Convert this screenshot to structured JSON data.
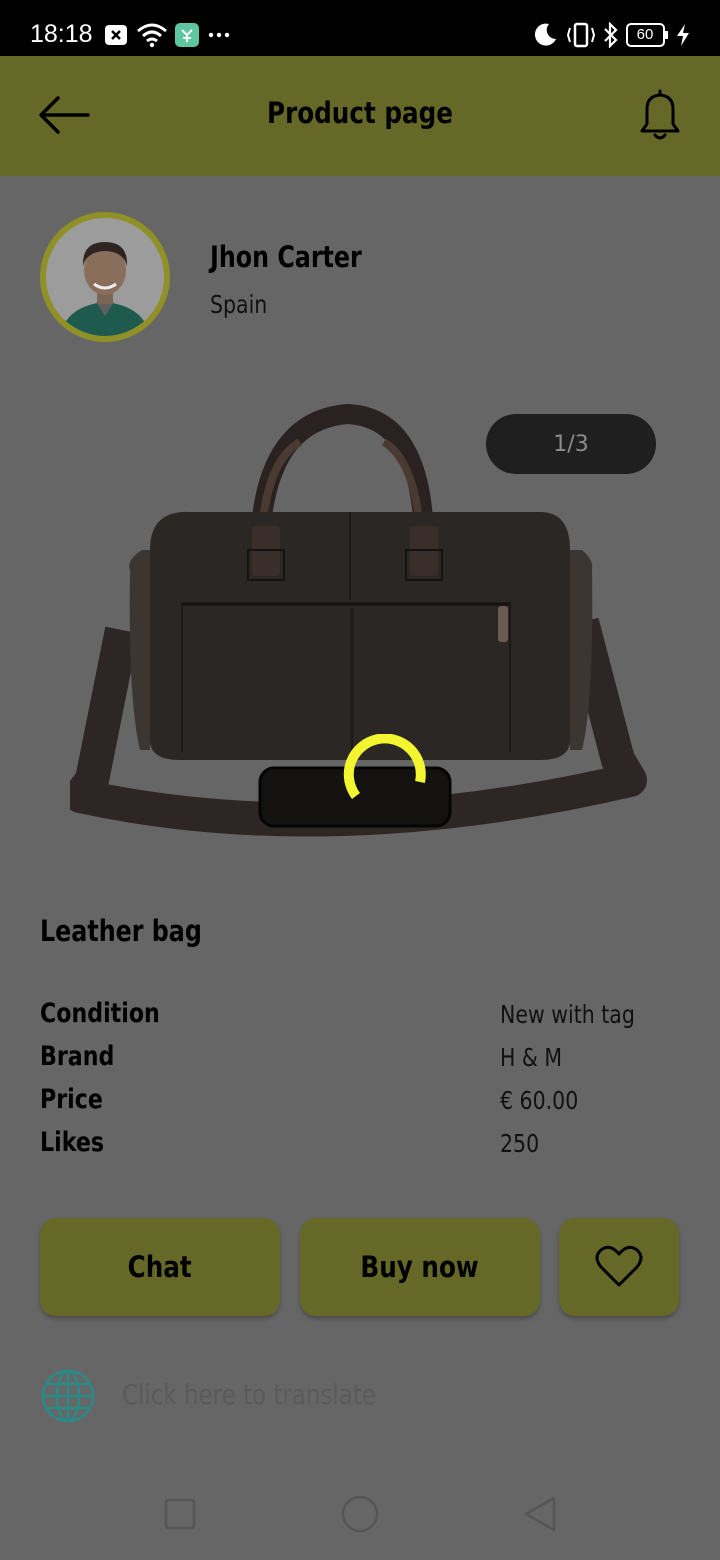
{
  "status_bar": {
    "time": "18:18",
    "battery_level": "60"
  },
  "header": {
    "title": "Product page"
  },
  "seller": {
    "name": "Jhon Carter",
    "location": "Spain"
  },
  "gallery": {
    "counter": "1/3"
  },
  "product": {
    "title": "Leather bag",
    "details": [
      {
        "label": "Condition",
        "value": "New with tag"
      },
      {
        "label": "Brand",
        "value": "H & M"
      },
      {
        "label": "Price",
        "value": "€ 60.00"
      },
      {
        "label": "Likes",
        "value": "250"
      }
    ]
  },
  "actions": {
    "chat_label": "Chat",
    "buy_label": "Buy now"
  },
  "translate": {
    "label": "Click here to translate"
  },
  "colors": {
    "header_bg": "#656826",
    "overlay_bg": "#666666",
    "avatar_ring": "#8f9126",
    "spinner": "#f2f530",
    "globe": "#2a8a86"
  }
}
